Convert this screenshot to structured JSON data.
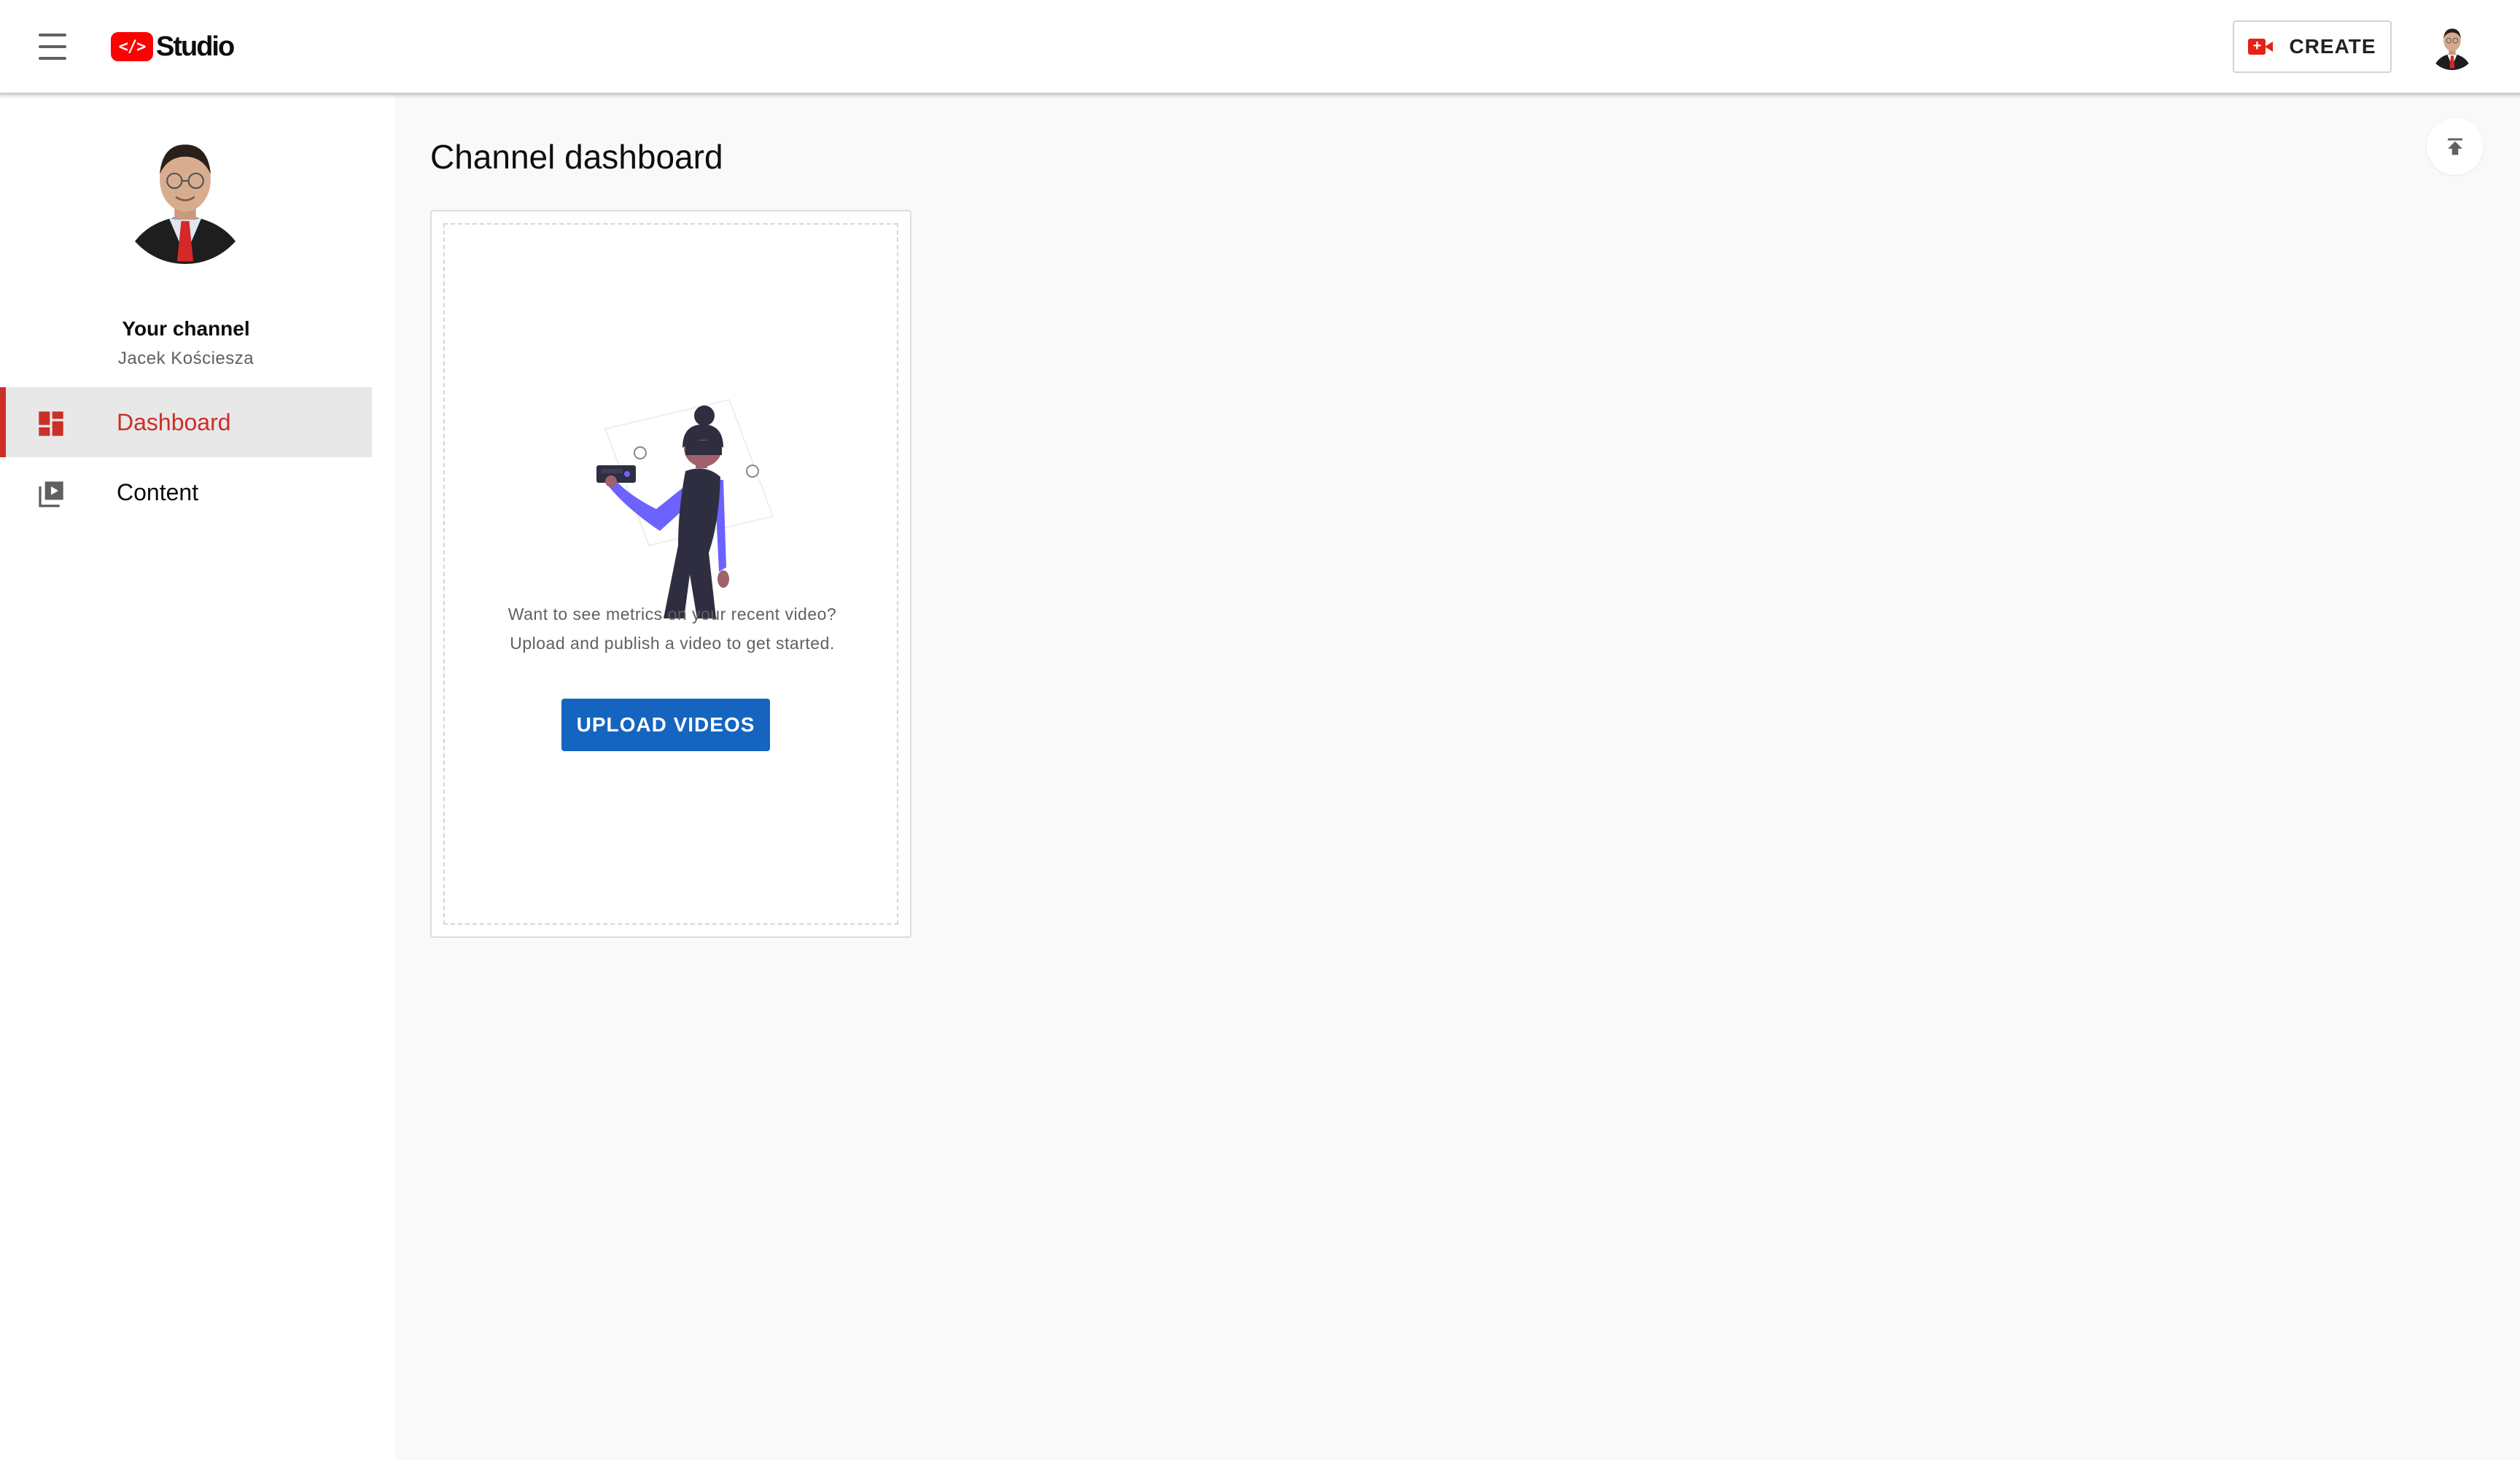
{
  "header": {
    "logo_badge": "</>",
    "logo_text": "Studio",
    "create_label": "CREATE"
  },
  "sidebar": {
    "channel_title": "Your channel",
    "channel_name": "Jacek Kościesza",
    "items": [
      {
        "label": "Dashboard",
        "icon": "dashboard-icon",
        "active": true
      },
      {
        "label": "Content",
        "icon": "video-library-icon",
        "active": false
      }
    ]
  },
  "main": {
    "title": "Channel dashboard",
    "card": {
      "message_line1": "Want to see metrics on your recent video?",
      "message_line2": "Upload and publish a video to get started.",
      "button_label": "UPLOAD VIDEOS"
    }
  },
  "colors": {
    "brand_red": "#ff0000",
    "active_nav": "#cc2e28",
    "primary_button": "#1565c0",
    "illustration_purple": "#6c63ff",
    "illustration_dark": "#2f2e41"
  }
}
